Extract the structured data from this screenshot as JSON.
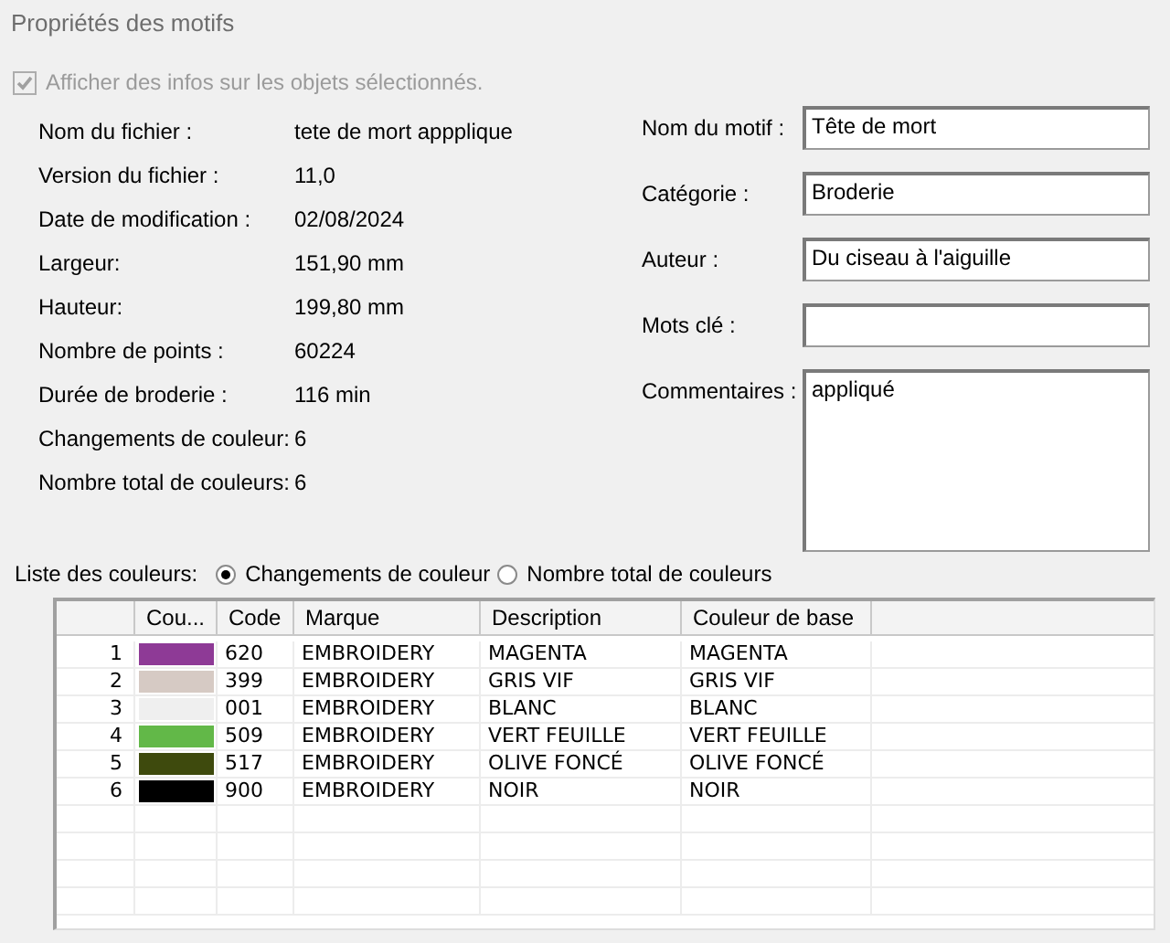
{
  "title": "Propriétés des motifs",
  "show_info": {
    "label": "Afficher des infos sur les objets sélectionnés.",
    "checked": true,
    "disabled": true
  },
  "info": [
    {
      "label": "Nom du fichier :",
      "value": "tete de mort appplique"
    },
    {
      "label": "Version du fichier :",
      "value": "11,0"
    },
    {
      "label": "Date de modification :",
      "value": "02/08/2024"
    },
    {
      "label": "Largeur:",
      "value": "151,90 mm"
    },
    {
      "label": "Hauteur:",
      "value": "199,80 mm"
    },
    {
      "label": "Nombre de points :",
      "value": "60224"
    },
    {
      "label": "Durée de broderie :",
      "value": "116 min"
    },
    {
      "label": "Changements de couleur:",
      "value": "6"
    },
    {
      "label": "Nombre total de couleurs:",
      "value": "6"
    }
  ],
  "fields": [
    {
      "label": "Nom du motif :",
      "value": "Tête de mort",
      "kind": "line"
    },
    {
      "label": "Catégorie :",
      "value": "Broderie",
      "kind": "line"
    },
    {
      "label": "Auteur :",
      "value": "Du ciseau à l'aiguille",
      "kind": "line"
    },
    {
      "label": "Mots clé :",
      "kind": "line"
    },
    {
      "label": "Commentaires :",
      "value": "appliqué",
      "kind": "multiline"
    }
  ],
  "color_list": {
    "label": "Liste des couleurs:",
    "options": [
      {
        "label": "Changements de couleur",
        "selected": true
      },
      {
        "label": "Nombre total de couleurs",
        "selected": false
      }
    ]
  },
  "table": {
    "columns": [
      "Cou...",
      "Code",
      "Marque",
      "Description",
      "Couleur de base"
    ],
    "rows": [
      {
        "number": "1",
        "color": "#8e3a96",
        "code": "620",
        "brand": "EMBROIDERY",
        "description": "MAGENTA",
        "base": "MAGENTA"
      },
      {
        "number": "2",
        "color": "#d6cac4",
        "code": "399",
        "brand": "EMBROIDERY",
        "description": "GRIS VIF",
        "base": "GRIS VIF"
      },
      {
        "number": "3",
        "color": "#efefef",
        "code": "001",
        "brand": "EMBROIDERY",
        "description": "BLANC",
        "base": "BLANC"
      },
      {
        "number": "4",
        "color": "#62b848",
        "code": "509",
        "brand": "EMBROIDERY",
        "description": "VERT FEUILLE",
        "base": "VERT FEUILLE"
      },
      {
        "number": "5",
        "color": "#3e4a0d",
        "code": "517",
        "brand": "EMBROIDERY",
        "description": "OLIVE FONCÉ",
        "base": "OLIVE FONCÉ"
      },
      {
        "number": "6",
        "color": "#000000",
        "code": "900",
        "brand": "EMBROIDERY",
        "description": "NOIR",
        "base": "NOIR"
      }
    ]
  }
}
